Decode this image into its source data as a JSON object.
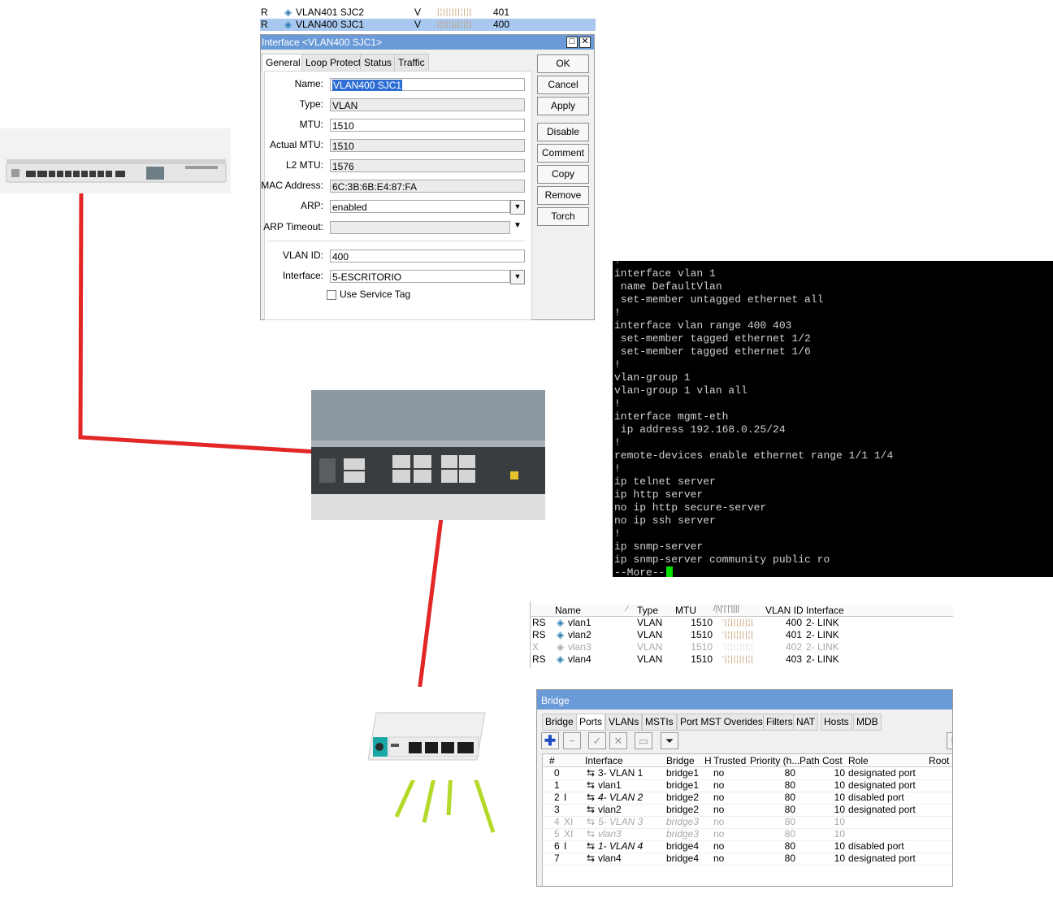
{
  "top_list": {
    "rows": [
      {
        "flag": "R",
        "name": "VLAN401 SJC2",
        "col": "V",
        "mtu": "401"
      },
      {
        "flag": "R",
        "name": "VLAN400 SJC1",
        "col": "V",
        "mtu": "400"
      }
    ]
  },
  "interface_dialog": {
    "title": "Interface <VLAN400 SJC1>",
    "tabs": [
      "General",
      "Loop Protect",
      "Status",
      "Traffic"
    ],
    "fields": {
      "name": {
        "label": "Name:",
        "value": "VLAN400 SJC1"
      },
      "type": {
        "label": "Type:",
        "value": "VLAN"
      },
      "mtu": {
        "label": "MTU:",
        "value": "1510"
      },
      "actual_mtu": {
        "label": "Actual MTU:",
        "value": "1510"
      },
      "l2_mtu": {
        "label": "L2 MTU:",
        "value": "1576"
      },
      "mac": {
        "label": "MAC Address:",
        "value": "6C:3B:6B:E4:87:FA"
      },
      "arp": {
        "label": "ARP:",
        "value": "enabled"
      },
      "arp_timeout": {
        "label": "ARP Timeout:",
        "value": ""
      },
      "vlan_id": {
        "label": "VLAN ID:",
        "value": "400"
      },
      "interface": {
        "label": "Interface:",
        "value": "5-ESCRITORIO"
      }
    },
    "use_service_tag": "Use Service Tag",
    "buttons": [
      "OK",
      "Cancel",
      "Apply",
      "Disable",
      "Comment",
      "Copy",
      "Remove",
      "Torch"
    ]
  },
  "terminal": {
    "lines": [
      "!",
      "interface vlan 1",
      " name DefaultVlan",
      " set-member untagged ethernet all",
      "!",
      "interface vlan range 400 403",
      " set-member tagged ethernet 1/2",
      " set-member tagged ethernet 1/6",
      "!",
      "vlan-group 1",
      "vlan-group 1 vlan all",
      "!",
      "interface mgmt-eth",
      " ip address 192.168.0.25/24",
      "!",
      "remote-devices enable ethernet range 1/1 1/4",
      "!",
      "ip telnet server",
      "ip http server",
      "no ip http secure-server",
      "no ip ssh server",
      "!",
      "ip snmp-server",
      "ip snmp-server community public ro",
      "--More--"
    ]
  },
  "vlan_table": {
    "headers": [
      "Name",
      "Type",
      "MTU",
      "VLAN ID",
      "Interface"
    ],
    "rows": [
      {
        "flag": "RS",
        "name": "vlan1",
        "type": "VLAN",
        "mtu": "1510",
        "vlan_id": "400",
        "interface": "2- LINK"
      },
      {
        "flag": "RS",
        "name": "vlan2",
        "type": "VLAN",
        "mtu": "1510",
        "vlan_id": "401",
        "interface": "2- LINK"
      },
      {
        "flag": "X",
        "name": "vlan3",
        "type": "VLAN",
        "mtu": "1510",
        "vlan_id": "402",
        "interface": "2- LINK"
      },
      {
        "flag": "RS",
        "name": "vlan4",
        "type": "VLAN",
        "mtu": "1510",
        "vlan_id": "403",
        "interface": "2- LINK"
      }
    ]
  },
  "bridge_window": {
    "title": "Bridge",
    "tabs": [
      "Bridge",
      "Ports",
      "VLANs",
      "MSTIs",
      "Port MST Overides",
      "Filters",
      "NAT",
      "Hosts",
      "MDB"
    ],
    "headers": [
      "#",
      "Interface",
      "Bridge",
      "H",
      "Trusted",
      "Priority (h...",
      "Path Cost",
      "Role",
      "Root P"
    ],
    "rows": [
      {
        "num": "0",
        "flag": "",
        "interface": "3- VLAN 1",
        "bridge": "bridge1",
        "trusted": "no",
        "priority": "80",
        "cost": "10",
        "role": "designated port"
      },
      {
        "num": "1",
        "flag": "",
        "interface": "vlan1",
        "bridge": "bridge1",
        "trusted": "no",
        "priority": "80",
        "cost": "10",
        "role": "designated port"
      },
      {
        "num": "2",
        "flag": "I",
        "interface": "4- VLAN 2",
        "bridge": "bridge2",
        "trusted": "no",
        "priority": "80",
        "cost": "10",
        "role": "disabled port"
      },
      {
        "num": "3",
        "flag": "",
        "interface": "vlan2",
        "bridge": "bridge2",
        "trusted": "no",
        "priority": "80",
        "cost": "10",
        "role": "designated port"
      },
      {
        "num": "4",
        "flag": "XI",
        "interface": "5- VLAN 3",
        "bridge": "bridge3",
        "trusted": "no",
        "priority": "80",
        "cost": "10",
        "role": ""
      },
      {
        "num": "5",
        "flag": "XI",
        "interface": "vlan3",
        "bridge": "bridge3",
        "trusted": "no",
        "priority": "80",
        "cost": "10",
        "role": ""
      },
      {
        "num": "6",
        "flag": "I",
        "interface": "1- VLAN 4",
        "bridge": "bridge4",
        "trusted": "no",
        "priority": "80",
        "cost": "10",
        "role": "disabled port"
      },
      {
        "num": "7",
        "flag": "",
        "interface": "vlan4",
        "bridge": "bridge4",
        "trusted": "no",
        "priority": "80",
        "cost": "10",
        "role": "designated port"
      }
    ]
  },
  "colors": {
    "title_bar": "#6a9ad8",
    "selection": "#a9c8ef",
    "cable_red": "#e32626",
    "cable_green": "#b5d92a",
    "terminal_bg": "#000000",
    "cursor": "#00e000"
  }
}
